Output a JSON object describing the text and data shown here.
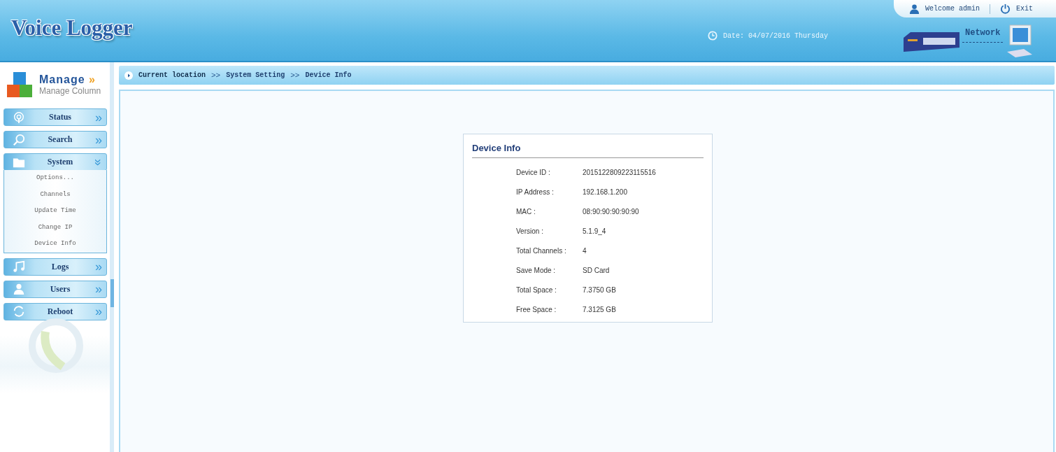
{
  "header": {
    "logo": "Voice Logger",
    "user": "Welcome admin",
    "exit": "Exit",
    "date": "Date: 04/07/2016 Thursday",
    "network": "Network"
  },
  "sidebar": {
    "title": "Manage",
    "title_mark": "»",
    "subtitle": "Manage Column",
    "items": [
      {
        "label": "Status",
        "chevron": "»",
        "expanded": false
      },
      {
        "label": "Search",
        "chevron": "»",
        "expanded": false
      },
      {
        "label": "System",
        "chevron": "»",
        "expanded": true,
        "children": [
          {
            "label": "Options..."
          },
          {
            "label": "Channels"
          },
          {
            "label": "Update Time"
          },
          {
            "label": "Change IP"
          },
          {
            "label": "Device Info"
          }
        ]
      },
      {
        "label": "Logs",
        "chevron": "»",
        "expanded": false
      },
      {
        "label": "Users",
        "chevron": "»",
        "expanded": false
      },
      {
        "label": "Reboot",
        "chevron": "»",
        "expanded": false
      }
    ]
  },
  "breadcrumb": [
    {
      "kind": "label",
      "text": "Current location"
    },
    {
      "kind": "separator",
      "text": ">>"
    },
    {
      "kind": "crumb",
      "text": "System Setting"
    },
    {
      "kind": "separator",
      "text": ">>"
    },
    {
      "kind": "crumb",
      "text": "Device Info"
    }
  ],
  "device_info": {
    "title": "Device Info",
    "rows": [
      {
        "label": "Device ID :",
        "value": "2015122809223115516"
      },
      {
        "label": "IP Address :",
        "value": "192.168.1.200"
      },
      {
        "label": "MAC :",
        "value": "08:90:90:90:90:90"
      },
      {
        "label": "Version :",
        "value": "5.1.9_4"
      },
      {
        "label": "Total Channels :",
        "value": "4"
      },
      {
        "label": "Save Mode :",
        "value": "SD Card"
      },
      {
        "label": "Total Space :",
        "value": "7.3750 GB"
      },
      {
        "label": "Free Space :",
        "value": "7.3125 GB"
      }
    ]
  }
}
